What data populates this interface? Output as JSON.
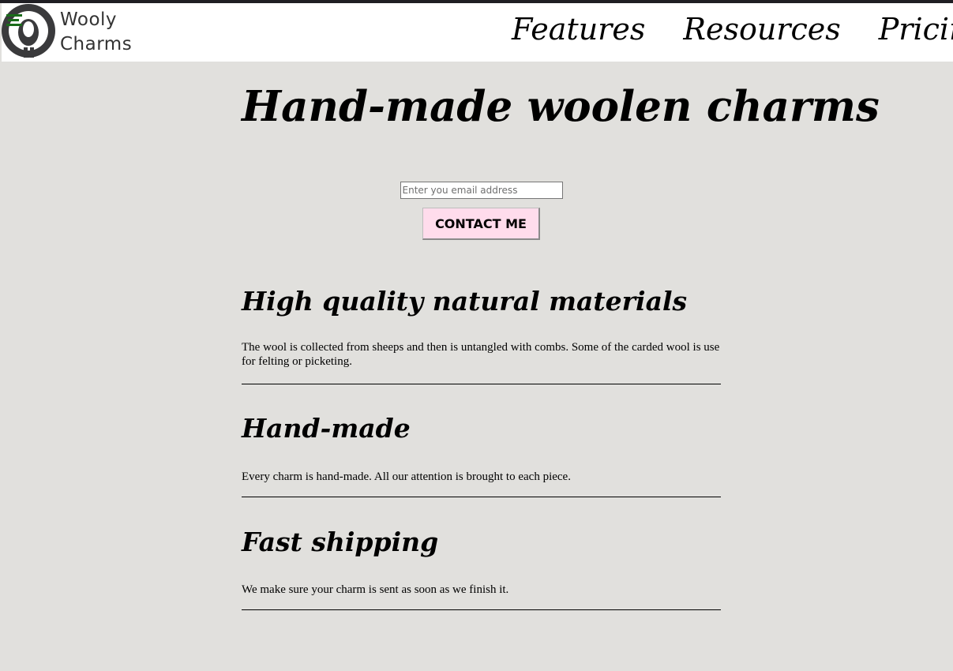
{
  "brand": {
    "logo_line1": "Wooly",
    "logo_line2": "Charms"
  },
  "nav": {
    "items": [
      {
        "label": "Features"
      },
      {
        "label": "Resources"
      },
      {
        "label": "Pricing"
      }
    ]
  },
  "hero": {
    "title": "Hand-made woolen charms"
  },
  "signup": {
    "email_placeholder": "Enter you email address",
    "email_value": "",
    "button_label": "CONTACT ME"
  },
  "features": [
    {
      "title": "High quality natural materials",
      "text": "The wool is collected from sheeps and then is untangled with combs. Some of the carded wool is use for felting or picketing."
    },
    {
      "title": "Hand-made",
      "text": "Every charm is hand-made. All our attention is brought to each piece."
    },
    {
      "title": "Fast shipping",
      "text": "We make sure your charm is sent as soon as we finish it."
    }
  ],
  "colors": {
    "page_background": "#e1e0dd",
    "header_background": "#ffffff",
    "button_background": "#ffdcec",
    "top_strip": "#1f1e23"
  }
}
